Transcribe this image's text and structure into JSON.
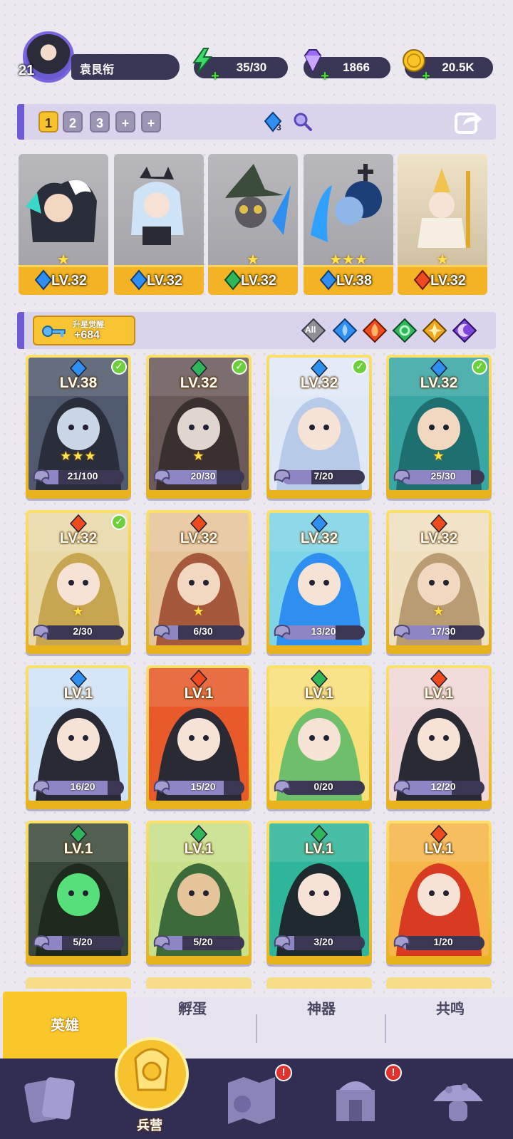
{
  "player": {
    "level": "21",
    "name": "袁艮衔"
  },
  "resources": {
    "stamina": "35/30",
    "gems": "1866",
    "gold": "20.5K"
  },
  "team_slots": [
    "1",
    "2",
    "3",
    "+",
    "+"
  ],
  "team_badge": "3",
  "team": [
    {
      "level": "LV.32",
      "element": "water",
      "stars": "★"
    },
    {
      "level": "LV.32",
      "element": "water",
      "stars": ""
    },
    {
      "level": "LV.32",
      "element": "wind",
      "stars": "★"
    },
    {
      "level": "LV.38",
      "element": "water",
      "stars": "★★★"
    },
    {
      "level": "LV.32",
      "element": "fire",
      "stars": "★"
    }
  ],
  "awaken": {
    "label": "升星觉醒",
    "value": "+684"
  },
  "filters": [
    "All",
    "water",
    "fire",
    "wind",
    "light",
    "dark"
  ],
  "filter_all_label": "All",
  "heroes": [
    {
      "level": "LV.38",
      "element": "water",
      "checked": true,
      "stars": "★★★",
      "progress": "21/100",
      "fraction": 0.21
    },
    {
      "level": "LV.32",
      "element": "wind",
      "checked": true,
      "stars": "★",
      "progress": "20/30",
      "fraction": 0.667
    },
    {
      "level": "LV.32",
      "element": "water",
      "checked": true,
      "stars": "",
      "progress": "7/20",
      "fraction": 0.35
    },
    {
      "level": "LV.32",
      "element": "water",
      "checked": true,
      "stars": "★",
      "progress": "25/30",
      "fraction": 0.833
    },
    {
      "level": "LV.32",
      "element": "fire",
      "checked": true,
      "stars": "★",
      "progress": "2/30",
      "fraction": 0.067
    },
    {
      "level": "LV.32",
      "element": "fire",
      "checked": false,
      "stars": "★",
      "progress": "6/30",
      "fraction": 0.2
    },
    {
      "level": "LV.32",
      "element": "water",
      "checked": false,
      "stars": "",
      "progress": "13/20",
      "fraction": 0.65
    },
    {
      "level": "LV.32",
      "element": "fire",
      "checked": false,
      "stars": "★",
      "progress": "17/30",
      "fraction": 0.567
    },
    {
      "level": "LV.1",
      "element": "water",
      "checked": false,
      "stars": "",
      "progress": "16/20",
      "fraction": 0.8
    },
    {
      "level": "LV.1",
      "element": "fire",
      "checked": false,
      "stars": "",
      "progress": "15/20",
      "fraction": 0.75
    },
    {
      "level": "LV.1",
      "element": "wind",
      "checked": false,
      "stars": "",
      "progress": "0/20",
      "fraction": 0
    },
    {
      "level": "LV.1",
      "element": "fire",
      "checked": false,
      "stars": "",
      "progress": "12/20",
      "fraction": 0.6
    },
    {
      "level": "LV.1",
      "element": "wind",
      "checked": false,
      "stars": "",
      "progress": "5/20",
      "fraction": 0.25
    },
    {
      "level": "LV.1",
      "element": "wind",
      "checked": false,
      "stars": "",
      "progress": "5/20",
      "fraction": 0.25
    },
    {
      "level": "LV.1",
      "element": "wind",
      "checked": false,
      "stars": "",
      "progress": "3/20",
      "fraction": 0.15
    },
    {
      "level": "LV.1",
      "element": "fire",
      "checked": false,
      "stars": "",
      "progress": "1/20",
      "fraction": 0.05
    }
  ],
  "tabs": [
    "英雄",
    "孵蛋",
    "神器",
    "共鸣"
  ],
  "nav": {
    "active_label": "兵营",
    "badge": "!",
    "items": [
      "cards-icon",
      "barracks-icon",
      "map-icon",
      "temple-icon",
      "mushroom-icon"
    ]
  },
  "colors": {
    "water": "#2f8ff0",
    "fire": "#ee4a1e",
    "wind": "#2fb65a",
    "light": "#f1a51d",
    "dark": "#7d45d8",
    "accent": "#6e5bd3",
    "gold": "#f6c22e",
    "nav_bg": "#322d52"
  }
}
